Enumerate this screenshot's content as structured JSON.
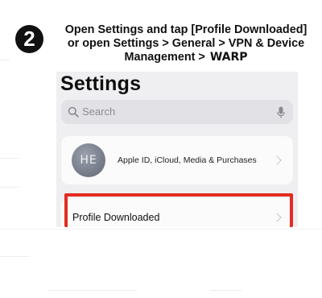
{
  "step": {
    "number": "2",
    "instruction_lines": [
      "Open Settings and tap [Profile Downloaded]",
      "or open Settings > General > VPN & Device",
      "Management >"
    ],
    "instruction_tail": "WARP"
  },
  "settings": {
    "title": "Settings",
    "search_placeholder": "Search",
    "apple_id": {
      "avatar_initials": "HE",
      "label": "Apple ID, iCloud, Media & Purchases"
    },
    "profile_downloaded": {
      "label": "Profile Downloaded"
    }
  },
  "colors": {
    "highlight": "#e42b22",
    "step_circle": "#111111"
  }
}
